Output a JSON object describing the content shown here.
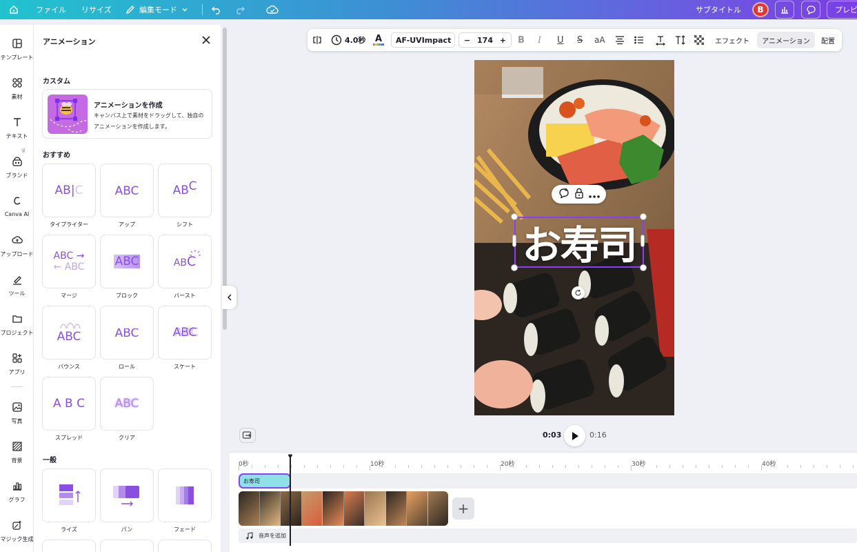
{
  "topbar": {
    "file": "ファイル",
    "resize": "リサイズ",
    "edit_mode": "編集モード",
    "subtitle": "サブタイトル",
    "avatar_initial": "B",
    "preview": "プレビ"
  },
  "rail": {
    "items": [
      {
        "label": "テンプレート",
        "icon": "layout-icon"
      },
      {
        "label": "素材",
        "icon": "elements-icon"
      },
      {
        "label": "テキスト",
        "icon": "text-icon"
      },
      {
        "label": "ブランド",
        "icon": "brand-icon"
      },
      {
        "label": "Canva AI",
        "icon": "ai-icon"
      },
      {
        "label": "アップロード",
        "icon": "upload-icon"
      },
      {
        "label": "ツール",
        "icon": "draw-icon"
      },
      {
        "label": "プロジェクト",
        "icon": "folder-icon"
      },
      {
        "label": "アプリ",
        "icon": "apps-icon"
      },
      {
        "label": "写真",
        "icon": "photo-icon"
      },
      {
        "label": "背景",
        "icon": "background-icon"
      },
      {
        "label": "グラフ",
        "icon": "chart-icon"
      },
      {
        "label": "マジック生成",
        "icon": "magic-icon"
      }
    ]
  },
  "panel": {
    "title": "アニメーション",
    "custom_section": "カスタム",
    "custom_card": {
      "title": "アニメーションを作成",
      "description": "キャンバス上で素材をドラッグして、独自のアニメーションを作成します。"
    },
    "recommended_section": "おすすめ",
    "recommended": [
      {
        "label": "タイプライター",
        "preview": "ABC"
      },
      {
        "label": "アップ",
        "preview": "ABC"
      },
      {
        "label": "シフト",
        "preview": "ABC"
      },
      {
        "label": "マージ",
        "preview": "ABC"
      },
      {
        "label": "ブロック",
        "preview": "ABC"
      },
      {
        "label": "バースト",
        "preview": "ABC"
      },
      {
        "label": "バウンス",
        "preview": "ABC"
      },
      {
        "label": "ロール",
        "preview": "ABC"
      },
      {
        "label": "スケート",
        "preview": "ABC"
      },
      {
        "label": "スプレッド",
        "preview": "A B C"
      },
      {
        "label": "クリア",
        "preview": "ABC"
      }
    ],
    "general_section": "一般",
    "general": [
      {
        "label": "ライズ"
      },
      {
        "label": "パン"
      },
      {
        "label": "フェード"
      }
    ]
  },
  "toolbar": {
    "duration": "4.0秒",
    "font": "AF-UVImpact",
    "font_size": "174",
    "minus": "−",
    "plus": "+",
    "case": "aA",
    "effect": "エフェクト",
    "animation": "アニメーション",
    "position": "配置"
  },
  "canvas": {
    "text": "お寿司"
  },
  "playback": {
    "current": "0:03",
    "total": "0:16"
  },
  "timeline": {
    "ruler": [
      "0秒",
      "10秒",
      "20秒",
      "30秒",
      "40秒"
    ],
    "text_clip": "お寿司",
    "add_audio": "音声を追加",
    "add_clip": "+"
  },
  "colors": {
    "accent": "#8b3dff",
    "text_clip": "#8ee1e6",
    "avatar": "#d63a3a"
  }
}
